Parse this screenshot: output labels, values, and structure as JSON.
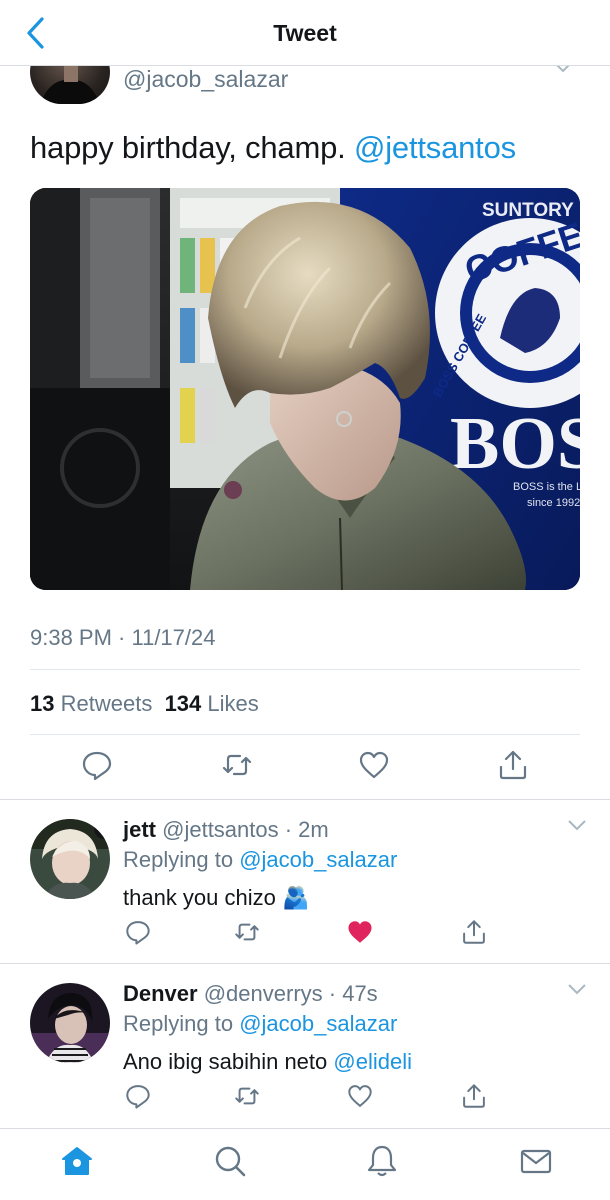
{
  "header": {
    "title": "Tweet",
    "back_icon": "chevron-left-icon"
  },
  "tweet": {
    "handle": "@jacob_salazar",
    "text": "happy birthday, champ. ",
    "mention": "@jettsantos",
    "photo": {
      "signage_brand": "SUNTORY",
      "signage_word": "COFFEE",
      "signage_ring": "BOSS COFFEE",
      "signage_logo": "BOSS",
      "signage_tagline_1": "BOSS is the L",
      "signage_tagline_2": "since 1992"
    },
    "timestamp": "9:38 PM · 11/17/24",
    "retweets_count": "13",
    "retweets_label": "Retweets",
    "likes_count": "134",
    "likes_label": "Likes"
  },
  "replies": [
    {
      "name": "jett",
      "handle": "@jettsantos",
      "time": " · 2m",
      "replying_label": "Replying to ",
      "replying_to": "@jacob_salazar",
      "text": "thank you chizo ",
      "emoji": "🫂",
      "liked": true
    },
    {
      "name": "Denver",
      "handle": "@denverrys",
      "time": " · 47s",
      "replying_label": "Replying to ",
      "replying_to": "@jacob_salazar",
      "text": "Ano ibig sabihin neto ",
      "mention": "@elideli",
      "liked": false
    }
  ],
  "colors": {
    "accent": "#1b95e0",
    "text_muted": "#657786",
    "like_red": "#e0245e",
    "divider": "#e1e8ed"
  },
  "tabbar": {
    "items": [
      "home-icon",
      "search-icon",
      "notifications-bell-icon",
      "messages-mail-icon"
    ],
    "active": "home-icon"
  }
}
